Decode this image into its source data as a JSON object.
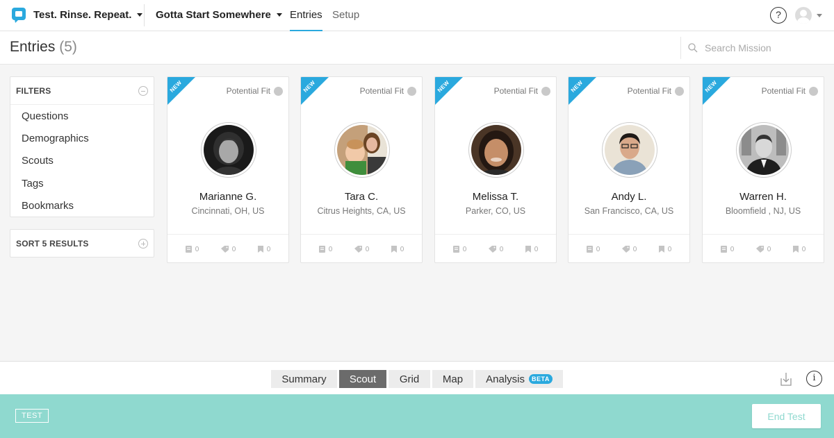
{
  "topnav": {
    "brand": "Test. Rinse. Repeat.",
    "mission": "Gotta Start Somewhere",
    "tabs": {
      "entries": "Entries",
      "setup": "Setup"
    },
    "help": "?"
  },
  "header": {
    "title": "Entries",
    "count": "(5)",
    "search_placeholder": "Search Mission"
  },
  "sidebar": {
    "filters_title": "FILTERS",
    "filters": [
      "Questions",
      "Demographics",
      "Scouts",
      "Tags",
      "Bookmarks"
    ],
    "sort_title": "SORT 5 RESULTS"
  },
  "cards": [
    {
      "badge": "NEW",
      "fit_label": "Potential Fit",
      "name": "Marianne G.",
      "location": "Cincinnati, OH, US",
      "stats": [
        "0",
        "0",
        "0"
      ]
    },
    {
      "badge": "NEW",
      "fit_label": "Potential Fit",
      "name": "Tara C.",
      "location": "Citrus Heights, CA, US",
      "stats": [
        "0",
        "0",
        "0"
      ]
    },
    {
      "badge": "NEW",
      "fit_label": "Potential Fit",
      "name": "Melissa T.",
      "location": "Parker, CO, US",
      "stats": [
        "0",
        "0",
        "0"
      ]
    },
    {
      "badge": "NEW",
      "fit_label": "Potential Fit",
      "name": "Andy L.",
      "location": "San Francisco, CA, US",
      "stats": [
        "0",
        "0",
        "0"
      ]
    },
    {
      "badge": "NEW",
      "fit_label": "Potential Fit",
      "name": "Warren H.",
      "location": "Bloomfield , NJ, US",
      "stats": [
        "0",
        "0",
        "0"
      ]
    }
  ],
  "bottombar": {
    "tabs": [
      "Summary",
      "Scout",
      "Grid",
      "Map",
      "Analysis"
    ],
    "active": "Scout",
    "beta": "BETA",
    "info": "i"
  },
  "footer": {
    "test_label": "TEST",
    "end_button": "End Test"
  },
  "colors": {
    "accent": "#2aa9de",
    "footer": "#8fd9cf",
    "active_tab": "#6b6b6b"
  }
}
